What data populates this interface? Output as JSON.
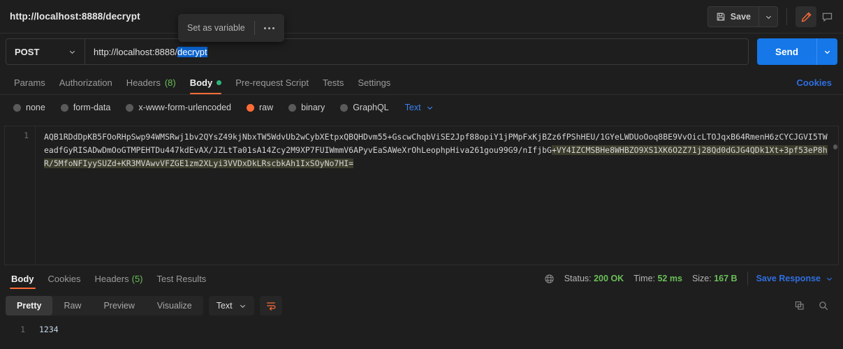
{
  "header": {
    "request_title": "http://localhost:8888/decrypt",
    "save_label": "Save",
    "save_icon": "floppy-disk-icon",
    "save_caret_icon": "chevron-down-icon",
    "edit_icon": "pencil-icon",
    "comment_icon": "comment-icon"
  },
  "popup": {
    "label": "Set as variable",
    "more_icon": "ellipsis-icon"
  },
  "url_row": {
    "method": "POST",
    "method_caret_icon": "chevron-down-icon",
    "url_prefix": "http://localhost:8888/",
    "url_selected": "decrypt",
    "send_label": "Send",
    "send_caret_icon": "chevron-down-icon"
  },
  "request_tabs": {
    "items": [
      {
        "label": "Params",
        "count": "",
        "dot": false
      },
      {
        "label": "Authorization",
        "count": "",
        "dot": false
      },
      {
        "label": "Headers",
        "count": "(8)",
        "dot": false
      },
      {
        "label": "Body",
        "count": "",
        "dot": true
      },
      {
        "label": "Pre-request Script",
        "count": "",
        "dot": false
      },
      {
        "label": "Tests",
        "count": "",
        "dot": false
      },
      {
        "label": "Settings",
        "count": "",
        "dot": false
      }
    ],
    "active_index": 3,
    "cookies_link": "Cookies"
  },
  "body_types": {
    "options": [
      {
        "label": "none",
        "selected": false
      },
      {
        "label": "form-data",
        "selected": false
      },
      {
        "label": "x-www-form-urlencoded",
        "selected": false
      },
      {
        "label": "raw",
        "selected": true
      },
      {
        "label": "binary",
        "selected": false
      },
      {
        "label": "GraphQL",
        "selected": false
      }
    ],
    "format_label": "Text",
    "format_caret_icon": "chevron-down-icon"
  },
  "body_editor": {
    "line_number": "1",
    "content_part1": "AQB1RDdDpKB5FOoRHpSwp94WMSRwj1bv2QYsZ49kjNbxTW5WdvUb2wCybXEtpxQBQHDvm55+GscwChqbViSE2Jpf88opiY1jPMpFxKjBZz6fPShHEU/1GYeLWDUoOoq8BE9VvOicLTOJqxB64RmenH6zCYCJGVI5TWeadfGyRISADwDmOoGTMPEHTDu447kdEvAX/JZLtTa01sA14Zcy2M9XP7FUIWmmV6APyvEaSAWeXrOhLeophpHiva261gou99G9/nIfjbG",
    "content_highlighted": "+VY4IZCMSBHe8WHBZO9XS1XK6O2Z71j28Qd0dGJG4QDk1Xt+3pf53eP8hR/5MfoNFIyySUZd+KR3MVAwvVFZGE1zm2XLyi3VVDxDkLRscbkAh1IxSOyNo7HI="
  },
  "response_tabs": {
    "items": [
      {
        "label": "Body",
        "count": ""
      },
      {
        "label": "Cookies",
        "count": ""
      },
      {
        "label": "Headers",
        "count": "(5)"
      },
      {
        "label": "Test Results",
        "count": ""
      }
    ],
    "active_index": 0,
    "globe_icon": "globe-icon",
    "status_label": "Status:",
    "status_value": "200 OK",
    "time_label": "Time:",
    "time_value": "52 ms",
    "size_label": "Size:",
    "size_value": "167 B",
    "save_response_label": "Save Response",
    "save_response_caret_icon": "chevron-down-icon"
  },
  "response_toolbar": {
    "views": [
      {
        "label": "Pretty"
      },
      {
        "label": "Raw"
      },
      {
        "label": "Preview"
      },
      {
        "label": "Visualize"
      }
    ],
    "active_view_index": 0,
    "format_label": "Text",
    "format_caret_icon": "chevron-down-icon",
    "wrap_icon": "word-wrap-icon",
    "copy_icon": "copy-icon",
    "search_icon": "search-icon"
  },
  "response_body": {
    "line_number": "1",
    "content": "1234"
  },
  "colors": {
    "accent_orange": "#ff6c37",
    "link_blue": "#2f6fe0",
    "send_blue": "#1577e8",
    "status_green": "#6bbf59",
    "selection_blue": "#0b63ce",
    "highlight_olive": "#3c3d2c",
    "background": "#1e1e1e"
  }
}
